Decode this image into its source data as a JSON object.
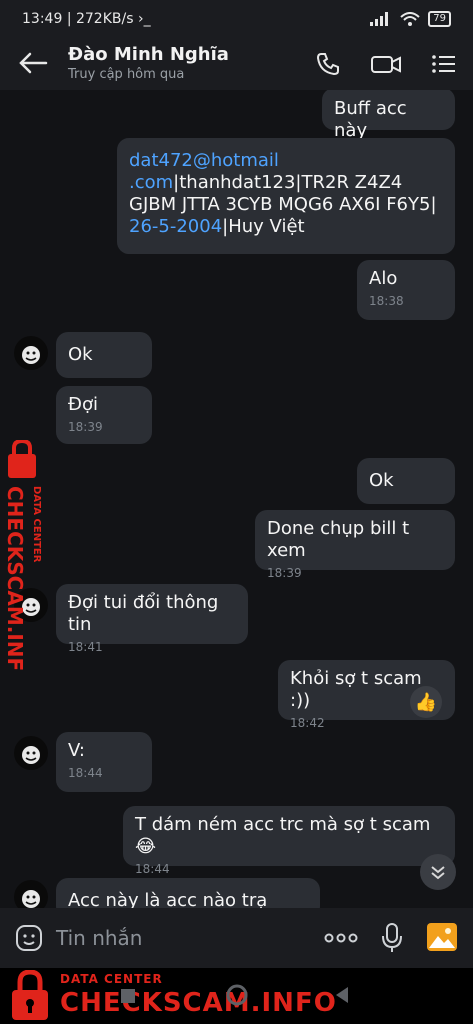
{
  "status_bar": {
    "time": "13:49",
    "speed": "272KB/s",
    "battery": "79"
  },
  "header": {
    "contact_name": "Đào Minh Nghĩa",
    "last_seen": "Truy cập hôm qua"
  },
  "messages": [
    {
      "side": "out",
      "text": "Buff acc này",
      "time": ""
    },
    {
      "side": "out",
      "email_line1": "dat472@hotmail",
      "email_line2": ".com",
      "text_after_email": "|thanhdat123|TR2R Z4Z4",
      "line3": "GJBM JTTA 3CYB MQG6 AX6I F6Y5|",
      "date_link": "26-5-2004",
      "text_after_date": "|Huy Việt"
    },
    {
      "side": "out",
      "text": "Alo",
      "time": "18:38"
    },
    {
      "side": "in",
      "text": "Ok",
      "time": ""
    },
    {
      "side": "in",
      "text": "Đợi",
      "time": "18:39"
    },
    {
      "side": "out",
      "text": "Ok",
      "time": ""
    },
    {
      "side": "out",
      "text": "Done chụp bill t xem",
      "time": "18:39"
    },
    {
      "side": "in",
      "text": "Đợi tui đổi thông tin",
      "time": "18:41"
    },
    {
      "side": "out",
      "text": "Khỏi sợ t scam :))",
      "time": "18:42"
    },
    {
      "side": "in",
      "text": "V:",
      "time": "18:44"
    },
    {
      "side": "out",
      "text": "T dám ném acc trc mà sợ t scam😂",
      "time": "18:44"
    },
    {
      "side": "in",
      "text": "Acc này là acc nào trạ video",
      "time": ""
    }
  ],
  "composer": {
    "placeholder": "Tin nhắn"
  },
  "watermark": {
    "label": "DATA CENTER",
    "title": "CHECKSCAM.INFO"
  },
  "colors": {
    "background": "#121316",
    "bubble": "#2b2e34",
    "link": "#4ea3ff",
    "watermark": "#e0241b"
  }
}
